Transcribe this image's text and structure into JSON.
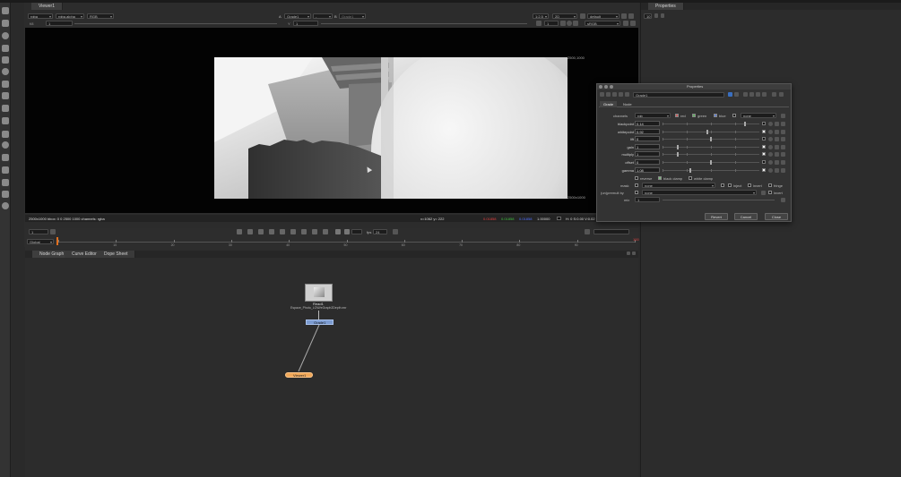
{
  "viewer": {
    "tab": "Viewer1",
    "channels": "rgba",
    "alpha": "rgba.alpha",
    "colorspace": "RGB",
    "input_a_label": "A",
    "input_a": "Grade1",
    "input_a2": "-",
    "input_b_label": "B",
    "input_b": "Grade1",
    "zoom": "1:2.5",
    "view_mode": "2D",
    "lut": "default",
    "gain_label": "f/8",
    "gain_value": "1",
    "gamma_label": "Y",
    "gamma_value": "1",
    "frame_value": "1",
    "display": "sRGB",
    "format_top": "2500,1000",
    "format_bottom": "2500x1000",
    "info": "2500x1000 bbox: 0 0 2500 1000 channels: rgba",
    "coords": "x=1062 y= 222",
    "pixel_r": "0.01858",
    "pixel_g": "0.01858",
    "pixel_b": "0.01858",
    "pixel_a": "1.00000",
    "hsv": "H: 0 S:0.00 V:0.02"
  },
  "timeline": {
    "frame": "1",
    "fps_label": "fps",
    "fps": "24",
    "range_mode": "Global",
    "ticks": [
      "1",
      "10",
      "20",
      "30",
      "40",
      "50",
      "60",
      "70",
      "80",
      "90",
      "100"
    ],
    "end": "100"
  },
  "nodegraph": {
    "tabs": [
      "Node Graph",
      "Curve Editor",
      "Dope Sheet"
    ],
    "read_label": "Read1",
    "read_file": "Espace_Photo_LOW/eGraph2Depth.exr",
    "grade_label": "Grade1",
    "viewer_label": "Viewer1"
  },
  "properties_panel": {
    "title": "Properties",
    "count": "10"
  },
  "dialog": {
    "title": "Properties",
    "node_name": "Grade1",
    "tabs": [
      "Grade",
      "Node"
    ],
    "channels_label": "channels",
    "channels_value": "rgb",
    "red_label": "red",
    "green_label": "green",
    "blue_label": "blue",
    "none_value": "none",
    "params": [
      {
        "label": "blackpoint",
        "value": "0.14",
        "level": 0.86
      },
      {
        "label": "whitepoint",
        "value": "0.92",
        "level": 0.46
      },
      {
        "label": "lift",
        "value": "0",
        "level": 0.5
      },
      {
        "label": "gain",
        "value": "1",
        "level": 0.15
      },
      {
        "label": "multiply",
        "value": "1",
        "level": 0.15
      },
      {
        "label": "offset",
        "value": "0",
        "level": 0.5
      },
      {
        "label": "gamma",
        "value": "1.08",
        "level": 0.28
      }
    ],
    "reverse_label": "reverse",
    "black_clamp_label": "black clamp",
    "white_clamp_label": "white clamp",
    "mask_label": "mask",
    "mask_value": "none",
    "inject_label": "inject",
    "invert_label": "invert",
    "fringe_label": "fringe",
    "premult_label": "(un)premult by",
    "premult_value": "none",
    "invert2_label": "invert",
    "mix_label": "mix",
    "mix_value": "1",
    "revert_label": "Revert",
    "cancel_label": "Cancel",
    "close_label": "Close"
  }
}
